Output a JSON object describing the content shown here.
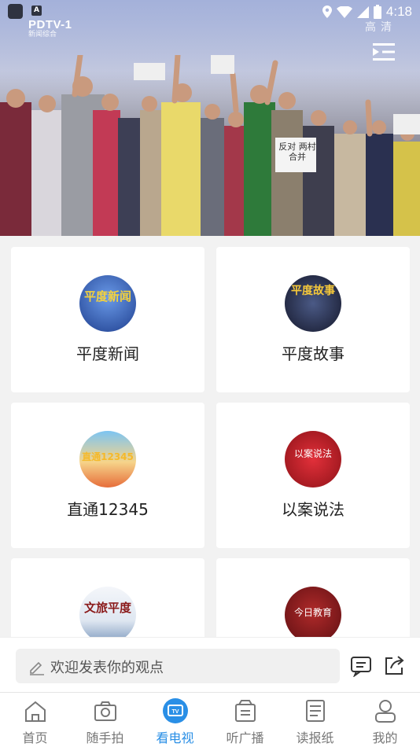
{
  "status_bar": {
    "time": "4:18"
  },
  "player": {
    "channel_logo": "PDTV-1",
    "channel_sub": "新闻综合",
    "quality": "高清",
    "sign_text": "反对 两村合并",
    "icons": [
      "playlist-icon"
    ]
  },
  "programs": [
    {
      "label": "平度新闻",
      "thumb_text": "平度新闻",
      "thumb_bg": "#2a4fa8"
    },
    {
      "label": "平度故事",
      "thumb_text": "平度故事",
      "thumb_bg": "#1f2a44"
    },
    {
      "label": "直通12345",
      "thumb_text": "直通12345",
      "thumb_bg": "#3a9ee0"
    },
    {
      "label": "以案说法",
      "thumb_text": "以案说法",
      "thumb_bg": "#c9202a"
    },
    {
      "label": "",
      "thumb_text": "文旅平度",
      "thumb_bg": "#e8eef5"
    },
    {
      "label": "",
      "thumb_text": "今日教育",
      "thumb_bg": "#8c1a1a"
    }
  ],
  "comment": {
    "placeholder": "欢迎发表你的观点"
  },
  "nav": [
    {
      "label": "首页",
      "icon": "home-icon"
    },
    {
      "label": "随手拍",
      "icon": "camera-icon"
    },
    {
      "label": "看电视",
      "icon": "tv-icon"
    },
    {
      "label": "听广播",
      "icon": "radio-icon"
    },
    {
      "label": "读报纸",
      "icon": "newspaper-icon"
    },
    {
      "label": "我的",
      "icon": "user-icon"
    }
  ],
  "colors": {
    "accent": "#2a8fe6",
    "card": "#ffffff",
    "bg": "#f2f2f2"
  }
}
